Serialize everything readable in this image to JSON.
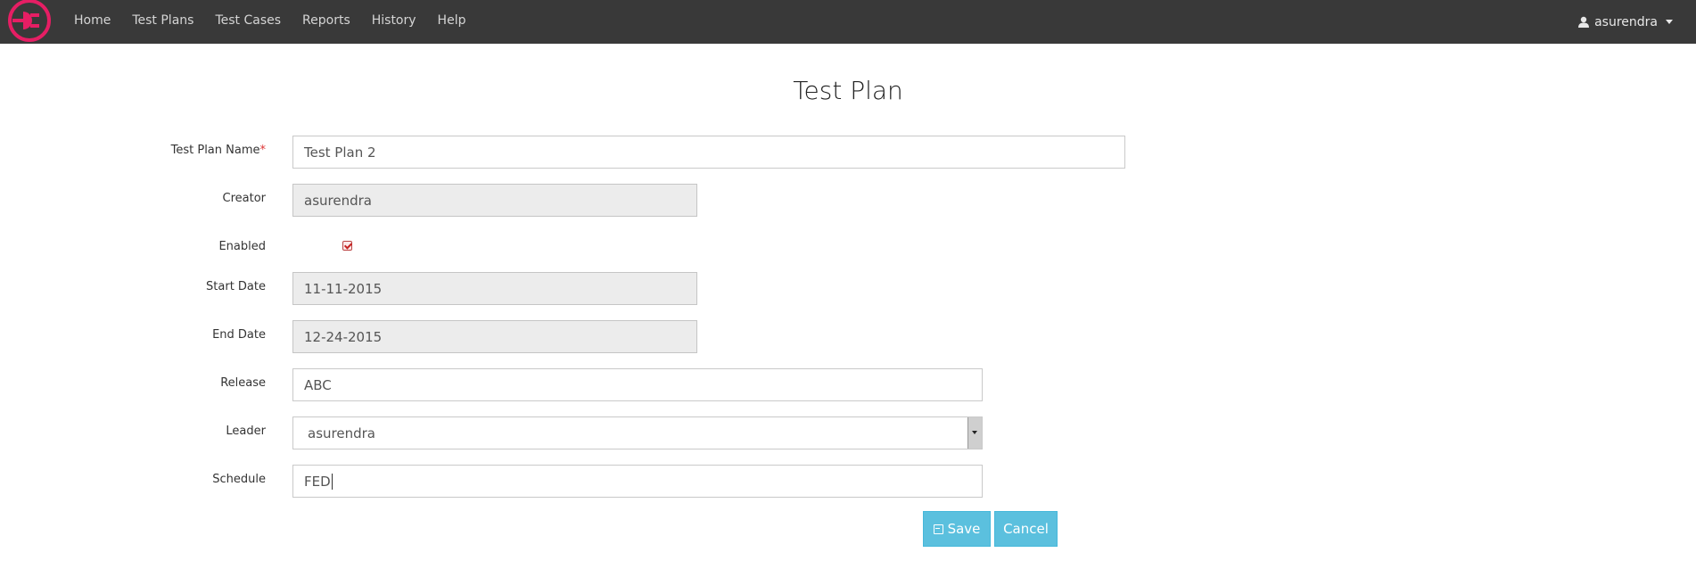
{
  "nav": {
    "items": [
      "Home",
      "Test Plans",
      "Test Cases",
      "Reports",
      "History",
      "Help"
    ],
    "user": "asurendra"
  },
  "page": {
    "title": "Test Plan"
  },
  "form": {
    "name_label": "Test Plan Name",
    "name_required": "*",
    "name_value": "Test Plan 2",
    "creator_label": "Creator",
    "creator_value": "asurendra",
    "enabled_label": "Enabled",
    "enabled_checked": true,
    "start_label": "Start Date",
    "start_value": "11-11-2015",
    "end_label": "End Date",
    "end_value": "12-24-2015",
    "release_label": "Release",
    "release_value": "ABC",
    "leader_label": "Leader",
    "leader_value": "asurendra",
    "schedule_label": "Schedule",
    "schedule_value": "FED"
  },
  "buttons": {
    "save": "Save",
    "cancel": "Cancel"
  },
  "colors": {
    "navbar": "#393939",
    "brand": "#e61e64",
    "button": "#5bc0de",
    "required": "#dd3333"
  }
}
